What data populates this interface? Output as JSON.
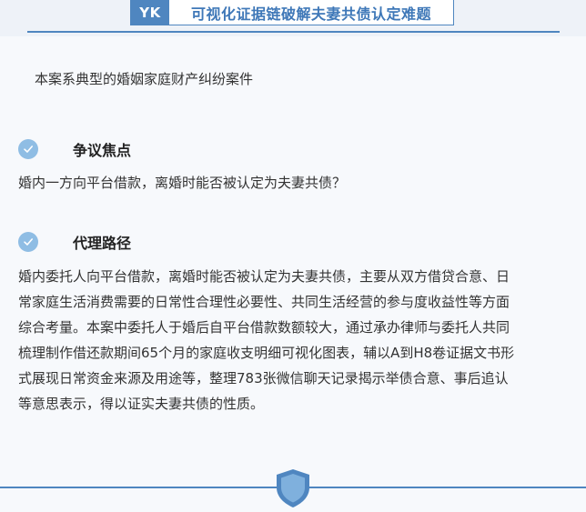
{
  "header": {
    "tag": "YK",
    "title": "可视化证据链破解夫妻共债认定难题"
  },
  "intro": "本案系典型的婚姻家庭财产纠纷案件",
  "sections": [
    {
      "title": "争议焦点",
      "body": "婚内一方向平台借款，离婚时能否被认定为夫妻共债？"
    },
    {
      "title": "代理路径",
      "lines": [
        "婚内委托人向平台借款，离婚时能否被认定为夫妻共债，主要从双方借贷合意、日",
        "常家庭生活消费需要的日常性合理性必要性、共同生活经营的参与度收益性等方面",
        "综合考量。本案中委托人于婚后自平台借款数额较大，通过承办律师与委托人共同",
        "梳理制作借还款期间65个月的家庭收支明细可视化图表，辅以A到H8卷证据文书形",
        "式展现日常资金来源及用途等，整理783张微信聊天记录揭示举债合意、事后追认",
        "等意思表示，得以证实夫妻共债的性质。"
      ]
    }
  ],
  "icons": {
    "section_icon": "check-circle-icon",
    "footer_icon": "shield-icon"
  },
  "colors": {
    "accent": "#4f86c0",
    "icon_fill": "#8fbde4",
    "background": "#f7f9fc"
  }
}
